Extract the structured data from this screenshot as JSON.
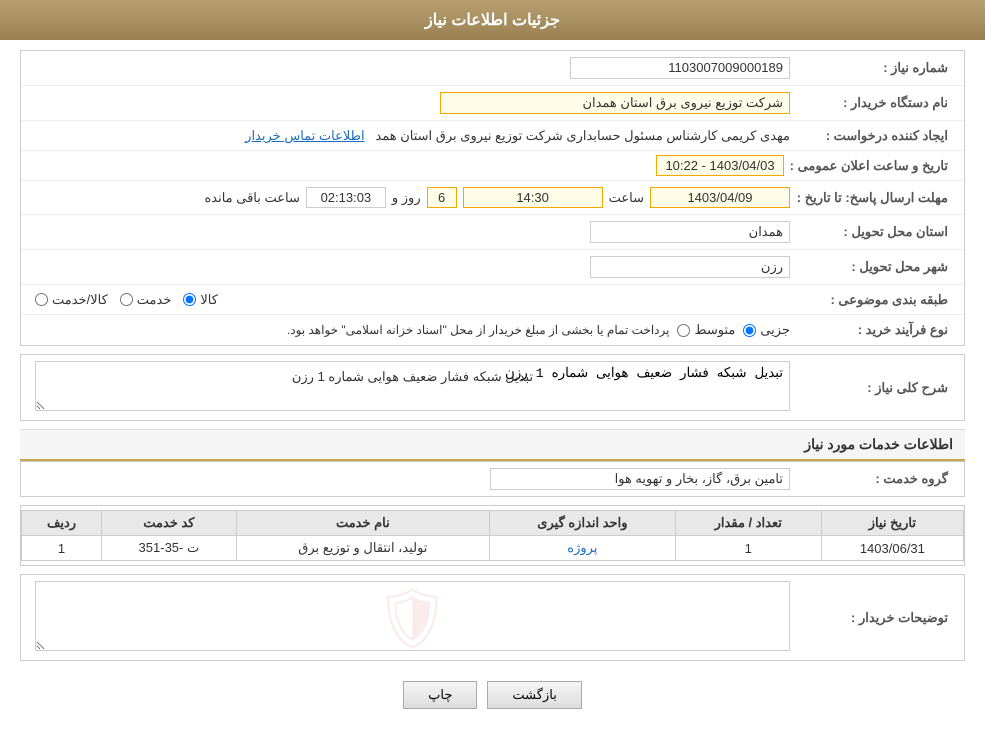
{
  "header": {
    "title": "جزئیات اطلاعات نیاز"
  },
  "fields": {
    "need_number_label": "شماره نیاز :",
    "need_number_value": "1103007009000189",
    "buyer_name_label": "نام دستگاه خریدار :",
    "buyer_name_value": "شرکت توزیع نیروی برق استان همدان",
    "creator_label": "ایجاد کننده درخواست :",
    "creator_value": "مهدی کریمی کارشناس مسئول حسابداری شرکت توزیع نیروی برق استان همد",
    "creator_link": "اطلاعات تماس خریدار",
    "announce_date_label": "تاریخ و ساعت اعلان عمومی :",
    "announce_date_value": "1403/04/03 - 10:22",
    "deadline_label": "مهلت ارسال پاسخ: تا تاریخ :",
    "deadline_date": "1403/04/09",
    "deadline_time": "14:30",
    "deadline_days": "6",
    "deadline_remaining": "02:13:03",
    "deadline_day_label": "روز و",
    "deadline_hour_label": "ساعت",
    "deadline_remaining_label": "ساعت باقی مانده",
    "province_label": "استان محل تحویل :",
    "province_value": "همدان",
    "city_label": "شهر محل تحویل :",
    "city_value": "رزن",
    "category_label": "طبقه بندی موضوعی :",
    "category_kala": "کالا",
    "category_khadamat": "خدمت",
    "category_kala_khadamat": "کالا/خدمت",
    "process_label": "نوع فرآیند خرید :",
    "process_jozei": "جزیی",
    "process_motawaset": "متوسط",
    "process_note": "پرداخت تمام یا بخشی از مبلغ خریدار از محل \"اسناد خزانه اسلامی\" خواهد بود.",
    "need_desc_label": "شرح کلی نیاز :",
    "need_desc_value": "تبدیل شبکه فشار ضعیف هوایی شماره 1 رزن",
    "service_info_title": "اطلاعات خدمات مورد نیاز",
    "service_group_label": "گروه خدمت :",
    "service_group_value": "تامین برق، گاز، بخار و تهویه هوا",
    "table_headers": {
      "row_num": "ردیف",
      "service_code": "کد خدمت",
      "service_name": "نام خدمت",
      "unit": "واحد اندازه گیری",
      "quantity": "تعداد / مقدار",
      "date": "تاریخ نیاز"
    },
    "table_rows": [
      {
        "row_num": "1",
        "service_code": "ت -35-351",
        "service_name": "تولید، انتقال و توزیع برق",
        "unit": "پروژه",
        "quantity": "1",
        "date": "1403/06/31"
      }
    ],
    "buyer_notes_label": "توضیحات خریدار :",
    "buyer_notes_value": ""
  },
  "buttons": {
    "print": "چاپ",
    "back": "بازگشت"
  }
}
